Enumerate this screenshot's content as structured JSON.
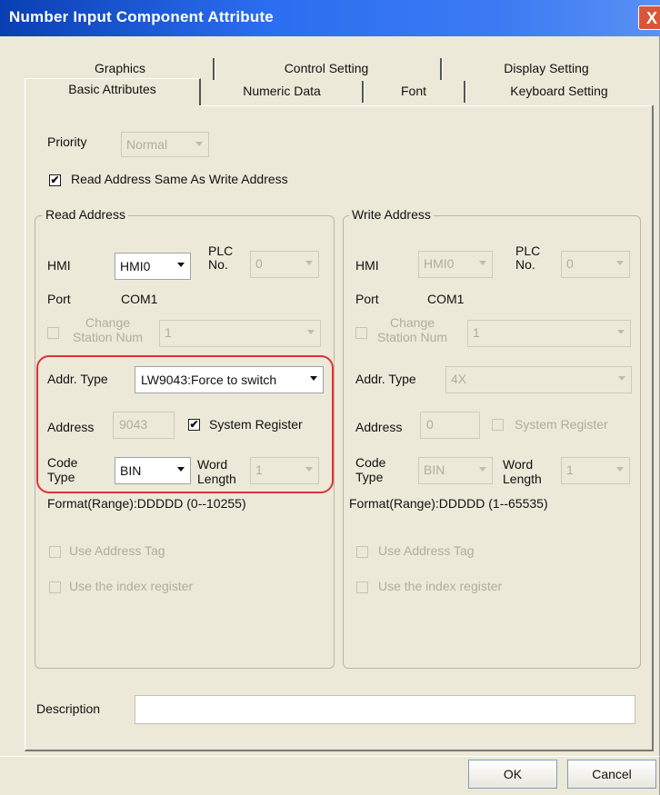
{
  "window": {
    "title": "Number Input Component Attribute",
    "close_glyph": "X"
  },
  "tabs_row1": [
    "Graphics",
    "Control Setting",
    "Display Setting"
  ],
  "tabs_row2": [
    "Basic Attributes",
    "Numeric Data",
    "Font",
    "Keyboard Setting"
  ],
  "priority": {
    "label": "Priority",
    "value": "Normal"
  },
  "same_address": {
    "label": "Read Address Same As Write Address",
    "checked": "✔"
  },
  "read": {
    "title": "Read Address",
    "hmi_label": "HMI",
    "hmi_value": "HMI0",
    "plc_label_1": "PLC",
    "plc_label_2": "No.",
    "plc_value": "0",
    "port_label": "Port",
    "port_value": "COM1",
    "change_1": "Change",
    "change_2": "Station Num",
    "station_value": "1",
    "addr_type_label": "Addr. Type",
    "addr_type_value": "LW9043:Force to switch",
    "address_label": "Address",
    "address_value": "9043",
    "sysreg_label": "System Register",
    "sysreg_checked": "✔",
    "code_1": "Code",
    "code_2": "Type",
    "code_value": "BIN",
    "word_1": "Word",
    "word_2": "Length",
    "word_value": "1",
    "format": "Format(Range):DDDDD (0--10255)",
    "use_tag": "Use Address Tag",
    "use_index": "Use the index register"
  },
  "write": {
    "title": "Write Address",
    "hmi_label": "HMI",
    "hmi_value": "HMI0",
    "plc_label_1": "PLC",
    "plc_label_2": "No.",
    "plc_value": "0",
    "port_label": "Port",
    "port_value": "COM1",
    "change_1": "Change",
    "change_2": "Station Num",
    "station_value": "1",
    "addr_type_label": "Addr. Type",
    "addr_type_value": "4X",
    "address_label": "Address",
    "address_value": "0",
    "sysreg_label": "System Register",
    "code_1": "Code",
    "code_2": "Type",
    "code_value": "BIN",
    "word_1": "Word",
    "word_2": "Length",
    "word_value": "1",
    "format": "Format(Range):DDDDD (1--65535)",
    "use_tag": "Use Address Tag",
    "use_index": "Use the index register"
  },
  "description": {
    "label": "Description",
    "value": ""
  },
  "buttons": {
    "ok": "OK",
    "cancel": "Cancel"
  },
  "colors": {
    "title_bar": "#2b6df0",
    "dialog_bg": "#ece9d8",
    "highlight": "#e03136"
  }
}
